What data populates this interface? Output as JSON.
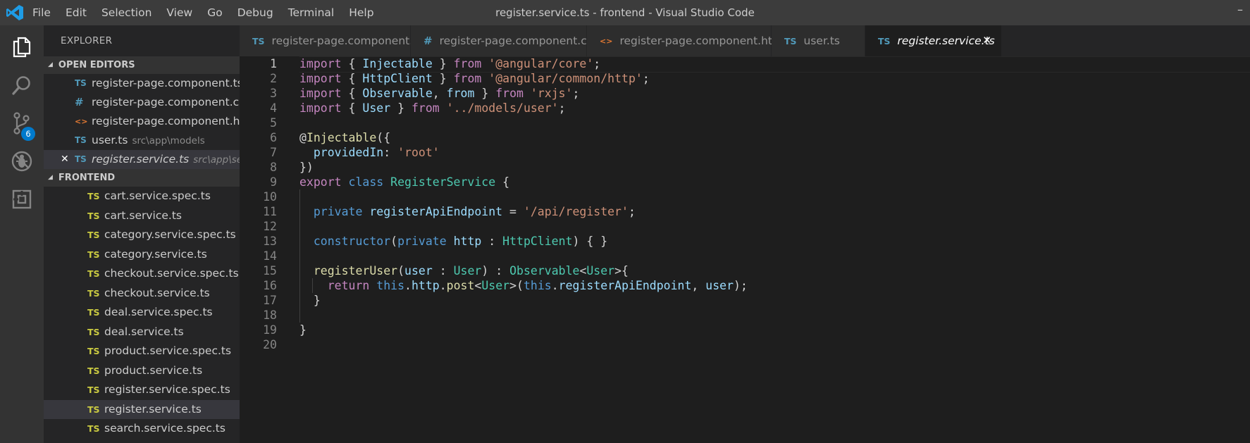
{
  "window": {
    "title": "register.service.ts - frontend - Visual Studio Code",
    "menu": [
      "File",
      "Edit",
      "Selection",
      "View",
      "Go",
      "Debug",
      "Terminal",
      "Help"
    ],
    "control_glyph": "–"
  },
  "activity_bar": {
    "items": [
      "explorer-icon",
      "search-icon",
      "source-control-icon",
      "debug-icon",
      "extensions-icon"
    ],
    "scm_badge": "6"
  },
  "sidebar": {
    "title": "EXPLORER",
    "open_editors": {
      "label": "OPEN EDITORS",
      "items": [
        {
          "icon": "TS",
          "name": "register-page.component.ts",
          "path": ""
        },
        {
          "icon": "#",
          "name": "register-page.component.css",
          "path": ""
        },
        {
          "icon": "<>",
          "name": "register-page.component.html",
          "path": ""
        },
        {
          "icon": "TS",
          "name": "user.ts",
          "path": "src\\app\\models"
        },
        {
          "icon": "TS",
          "name": "register.service.ts",
          "path": "src\\app\\services"
        }
      ]
    },
    "folder": {
      "label": "FRONTEND",
      "files": [
        "cart.service.spec.ts",
        "cart.service.ts",
        "category.service.spec.ts",
        "category.service.ts",
        "checkout.service.spec.ts",
        "checkout.service.ts",
        "deal.service.spec.ts",
        "deal.service.ts",
        "product.service.spec.ts",
        "product.service.ts",
        "register.service.spec.ts",
        "register.service.ts",
        "search.service.spec.ts"
      ]
    }
  },
  "tabs": [
    {
      "icon": "TS",
      "label": "register-page.component.ts"
    },
    {
      "icon": "#",
      "label": "register-page.component.css"
    },
    {
      "icon": "<>",
      "label": "register-page.component.html"
    },
    {
      "icon": "TS",
      "label": "user.ts"
    },
    {
      "icon": "TS",
      "label": "register.service.ts",
      "close": "✕"
    }
  ],
  "editor": {
    "line_numbers": [
      "1",
      "2",
      "3",
      "4",
      "5",
      "6",
      "7",
      "8",
      "9",
      "10",
      "11",
      "12",
      "13",
      "14",
      "15",
      "16",
      "17",
      "18",
      "19",
      "20"
    ],
    "lines": [
      [
        [
          "kw",
          "import"
        ],
        [
          "tx",
          " { "
        ],
        [
          "va",
          "Injectable"
        ],
        [
          "tx",
          " } "
        ],
        [
          "kw",
          "from"
        ],
        [
          "tx",
          " "
        ],
        [
          "st",
          "'@angular/core'"
        ],
        [
          "tx",
          ";"
        ]
      ],
      [
        [
          "kw",
          "import"
        ],
        [
          "tx",
          " { "
        ],
        [
          "va",
          "HttpClient"
        ],
        [
          "tx",
          " } "
        ],
        [
          "kw",
          "from"
        ],
        [
          "tx",
          " "
        ],
        [
          "st",
          "'@angular/common/http'"
        ],
        [
          "tx",
          ";"
        ]
      ],
      [
        [
          "kw",
          "import"
        ],
        [
          "tx",
          " { "
        ],
        [
          "va",
          "Observable"
        ],
        [
          "tx",
          ", "
        ],
        [
          "va",
          "from"
        ],
        [
          "tx",
          " } "
        ],
        [
          "kw",
          "from"
        ],
        [
          "tx",
          " "
        ],
        [
          "st",
          "'rxjs'"
        ],
        [
          "tx",
          ";"
        ]
      ],
      [
        [
          "kw",
          "import"
        ],
        [
          "tx",
          " { "
        ],
        [
          "va",
          "User"
        ],
        [
          "tx",
          " } "
        ],
        [
          "kw",
          "from"
        ],
        [
          "tx",
          " "
        ],
        [
          "st",
          "'../models/user'"
        ],
        [
          "tx",
          ";"
        ]
      ],
      [],
      [
        [
          "tx",
          "@"
        ],
        [
          "fn",
          "Injectable"
        ],
        [
          "tx",
          "({"
        ]
      ],
      [
        [
          "tx",
          "  "
        ],
        [
          "va",
          "providedIn"
        ],
        [
          "tx",
          ": "
        ],
        [
          "st",
          "'root'"
        ]
      ],
      [
        [
          "tx",
          "})"
        ]
      ],
      [
        [
          "kw",
          "export"
        ],
        [
          "tx",
          " "
        ],
        [
          "bl",
          "class"
        ],
        [
          "tx",
          " "
        ],
        [
          "ty",
          "RegisterService"
        ],
        [
          "tx",
          " {"
        ]
      ],
      [],
      [
        [
          "tx",
          "  "
        ],
        [
          "bl",
          "private"
        ],
        [
          "tx",
          " "
        ],
        [
          "va",
          "registerApiEndpoint"
        ],
        [
          "tx",
          " = "
        ],
        [
          "st",
          "'/api/register'"
        ],
        [
          "tx",
          ";"
        ]
      ],
      [],
      [
        [
          "tx",
          "  "
        ],
        [
          "bl",
          "constructor"
        ],
        [
          "tx",
          "("
        ],
        [
          "bl",
          "private"
        ],
        [
          "tx",
          " "
        ],
        [
          "va",
          "http"
        ],
        [
          "tx",
          " : "
        ],
        [
          "ty",
          "HttpClient"
        ],
        [
          "tx",
          ") { }"
        ]
      ],
      [],
      [
        [
          "tx",
          "  "
        ],
        [
          "fn",
          "registerUser"
        ],
        [
          "tx",
          "("
        ],
        [
          "va",
          "user"
        ],
        [
          "tx",
          " : "
        ],
        [
          "ty",
          "User"
        ],
        [
          "tx",
          ") : "
        ],
        [
          "ty",
          "Observable"
        ],
        [
          "tx",
          "<"
        ],
        [
          "ty",
          "User"
        ],
        [
          "tx",
          ">{"
        ]
      ],
      [
        [
          "tx",
          "    "
        ],
        [
          "kw",
          "return"
        ],
        [
          "tx",
          " "
        ],
        [
          "bl",
          "this"
        ],
        [
          "tx",
          "."
        ],
        [
          "va",
          "http"
        ],
        [
          "tx",
          "."
        ],
        [
          "fn",
          "post"
        ],
        [
          "tx",
          "<"
        ],
        [
          "ty",
          "User"
        ],
        [
          "tx",
          ">("
        ],
        [
          "bl",
          "this"
        ],
        [
          "tx",
          "."
        ],
        [
          "va",
          "registerApiEndpoint"
        ],
        [
          "tx",
          ", "
        ],
        [
          "va",
          "user"
        ],
        [
          "tx",
          ");"
        ]
      ],
      [
        [
          "tx",
          "  }"
        ]
      ],
      [],
      [
        [
          "tx",
          "}"
        ]
      ],
      []
    ]
  },
  "colors": {
    "accent": "#007acc",
    "ts_icon": "#519aba",
    "ts_tree_icon": "#cbcb41",
    "html_icon": "#e37933"
  }
}
